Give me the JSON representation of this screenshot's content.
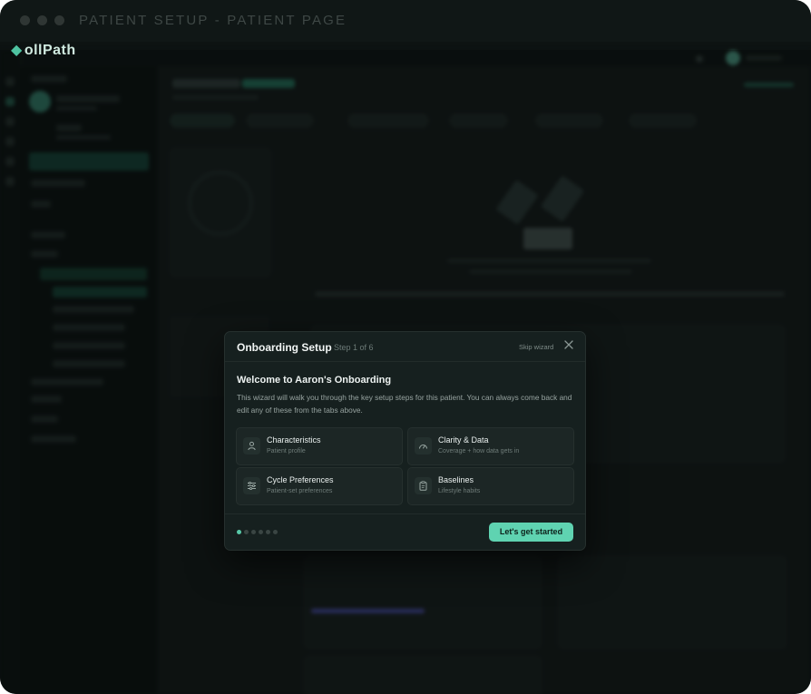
{
  "window": {
    "title": "PATIENT SETUP - PATIENT PAGE",
    "logo": "ollPath"
  },
  "modal": {
    "title": "Onboarding Setup",
    "step": "Step 1 of 6",
    "skip_label": "Skip wizard",
    "heading": "Welcome to Aaron's Onboarding",
    "description": "This wizard will walk you through the key setup steps for this patient. You can always come back and edit any of these from the tabs above.",
    "cards": [
      {
        "title": "Characteristics",
        "subtitle": "Patient profile",
        "icon": "person-icon"
      },
      {
        "title": "Clarity & Data",
        "subtitle": "Coverage + how data gets in",
        "icon": "gauge-icon"
      },
      {
        "title": "Cycle Preferences",
        "subtitle": "Patient-set preferences",
        "icon": "sliders-icon"
      },
      {
        "title": "Baselines",
        "subtitle": "Lifestyle habits",
        "icon": "clipboard-icon"
      }
    ],
    "pagination": {
      "total": 6,
      "current": 1
    },
    "cta_label": "Let's get started"
  },
  "colors": {
    "accent": "#5fd3b1",
    "background": "#0d1312",
    "modal": "#16201f"
  }
}
